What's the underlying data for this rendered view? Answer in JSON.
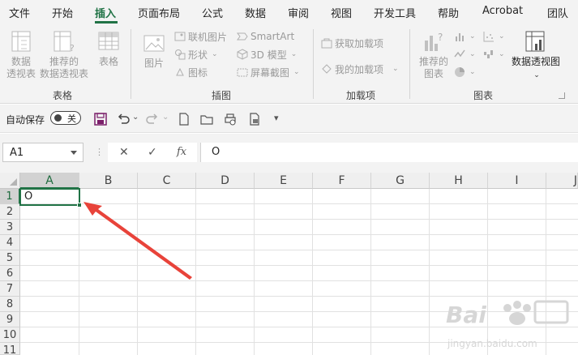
{
  "menu_tabs": [
    "文件",
    "开始",
    "插入",
    "页面布局",
    "公式",
    "数据",
    "审阅",
    "视图",
    "开发工具",
    "帮助",
    "Acrobat",
    "团队"
  ],
  "active_tab": "插入",
  "ribbon": {
    "tables_group": {
      "label": "表格",
      "pivot_table": [
        "数据",
        "透视表"
      ],
      "recommended_pivot": [
        "推荐的",
        "数据透视表"
      ],
      "table": "表格"
    },
    "illustrations_group": {
      "label": "插图",
      "pictures": "图片",
      "online_pictures": "联机图片",
      "shapes": "形状",
      "icons": "图标",
      "smartart": "SmartArt",
      "model_3d": "3D 模型",
      "screenshot": "屏幕截图"
    },
    "addins_group": {
      "label": "加载项",
      "get_addins": "获取加载项",
      "my_addins": "我的加载项"
    },
    "charts_group": {
      "label": "图表",
      "recommended_charts": [
        "推荐的",
        "图表"
      ],
      "pivot_chart": "数据透视图"
    }
  },
  "quick_access": {
    "autosave_label": "自动保存",
    "autosave_state": "关"
  },
  "formula_bar": {
    "name_box": "A1",
    "cancel": "✕",
    "enter": "✓",
    "fx": "fx",
    "content": "O"
  },
  "grid": {
    "columns": [
      "A",
      "B",
      "C",
      "D",
      "E",
      "F",
      "G",
      "H",
      "I",
      "J"
    ],
    "rows": [
      "1",
      "2",
      "3",
      "4",
      "5",
      "6",
      "7",
      "8",
      "9",
      "10",
      "11"
    ],
    "selected_cell": "A1",
    "cell_a1": "O"
  },
  "colors": {
    "accent": "#217346",
    "arrow": "#e8433a",
    "ribbon_bg": "#f3f3f3"
  }
}
